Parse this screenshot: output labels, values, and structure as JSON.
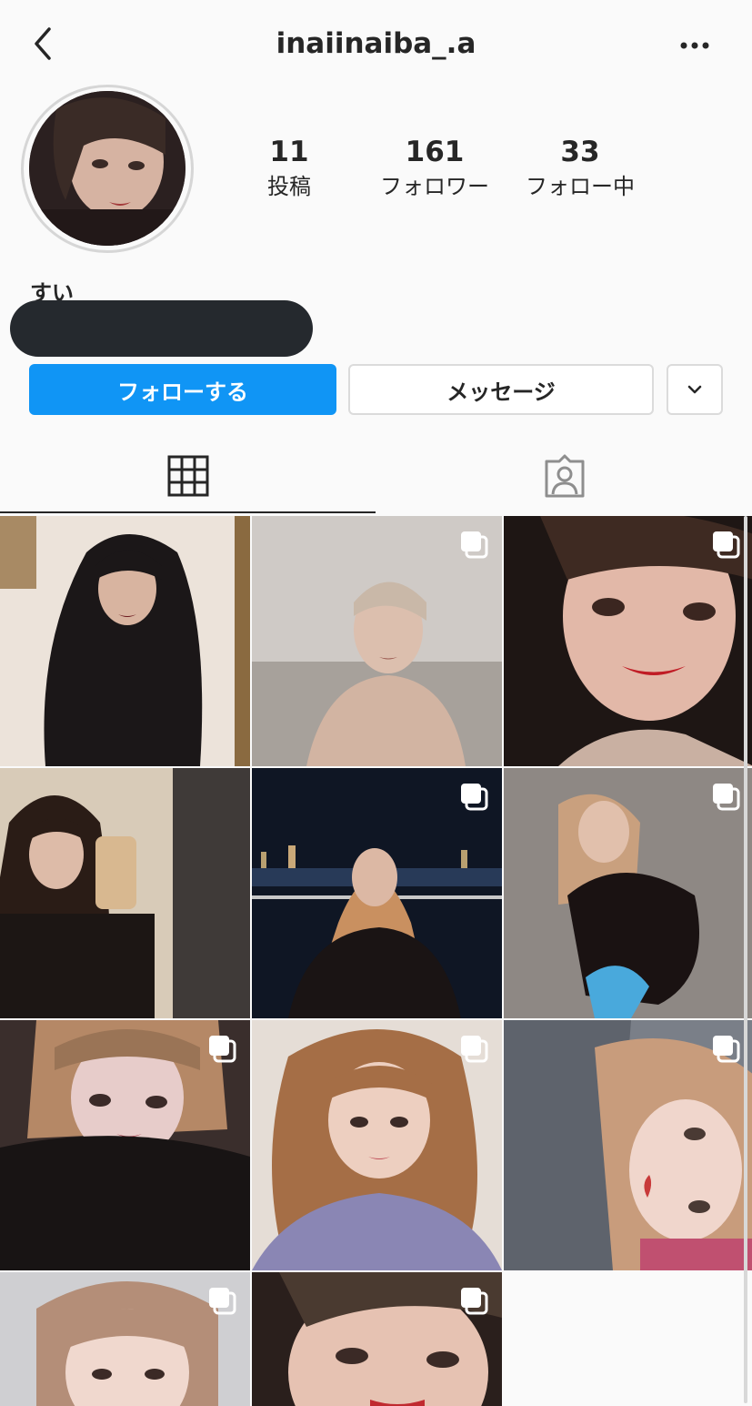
{
  "header": {
    "username": "inaiinaiba_.a",
    "back_icon": "chevron-left-icon",
    "more_icon": "ellipsis-icon"
  },
  "profile": {
    "display_name": "すい",
    "stats": [
      {
        "value": "11",
        "label": "投稿"
      },
      {
        "value": "161",
        "label": "フォロワー"
      },
      {
        "value": "33",
        "label": "フォロー中"
      }
    ]
  },
  "actions": {
    "follow_label": "フォローする",
    "message_label": "メッセージ",
    "dropdown_icon": "chevron-down-icon"
  },
  "tabs": [
    {
      "name": "posts",
      "icon": "grid-icon",
      "active": true
    },
    {
      "name": "tagged",
      "icon": "tagged-person-icon",
      "active": false
    }
  ],
  "posts": [
    {
      "multi": false
    },
    {
      "multi": true
    },
    {
      "multi": true
    },
    {
      "multi": false
    },
    {
      "multi": true
    },
    {
      "multi": true
    },
    {
      "multi": true
    },
    {
      "multi": true
    },
    {
      "multi": true
    },
    {
      "multi": true
    },
    {
      "multi": true
    }
  ],
  "colors": {
    "accent": "#1095f5",
    "background": "#fafafa",
    "text": "#262626",
    "border": "#dbdbdb"
  }
}
